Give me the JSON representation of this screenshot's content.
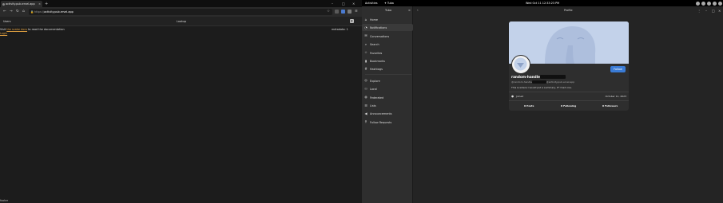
{
  "browser": {
    "tab_title": "activity.pub.ervel.app",
    "url_scheme": "https://",
    "url_host": "activity.pub.ervel.app",
    "header_left": "Users",
    "header_mid": "Lookup",
    "doc_prefix": "Visit",
    "doc_link": "the scalar docs",
    "doc_suffix": "to read the documentation",
    "metadata": "metadata: 1",
    "login": "Login",
    "footer": "footer"
  },
  "topbar": {
    "activities": "Activities",
    "app": "Tuba",
    "clock": "Wed Oct 11  12:33:23 PM"
  },
  "tuba": {
    "sidebar_title": "Tuba",
    "main_title": "Profile",
    "nav": [
      {
        "label": "Home",
        "icon": "home-icon"
      },
      {
        "label": "Notifications",
        "icon": "bell-icon"
      },
      {
        "label": "Conversations",
        "icon": "mail-icon"
      },
      {
        "label": "Search",
        "icon": "search-icon"
      },
      {
        "label": "Favorites",
        "icon": "star-icon"
      },
      {
        "label": "Bookmarks",
        "icon": "bookmark-icon"
      },
      {
        "label": "Hashtags",
        "icon": "hashtag-icon"
      },
      {
        "label": "Explore",
        "icon": "compass-icon"
      },
      {
        "label": "Local",
        "icon": "people-icon"
      },
      {
        "label": "Federated",
        "icon": "globe-icon"
      },
      {
        "label": "Lists",
        "icon": "list-icon"
      },
      {
        "label": "Announcements",
        "icon": "megaphone-icon"
      },
      {
        "label": "Follow Requests",
        "icon": "person-add-icon"
      }
    ],
    "profile": {
      "display_name": "random-handle",
      "handle_prefix": "@random-handle",
      "handle_suffix": "@activity.pub.ervel.app",
      "bio": "This is where I would put a summary, IF I had one.",
      "joined_label": "Joined",
      "joined_date": "October 11, 2023",
      "follow_label": "Follow",
      "posts": "0 Posts",
      "following": "0 Following",
      "followers": "0 Followers"
    }
  }
}
